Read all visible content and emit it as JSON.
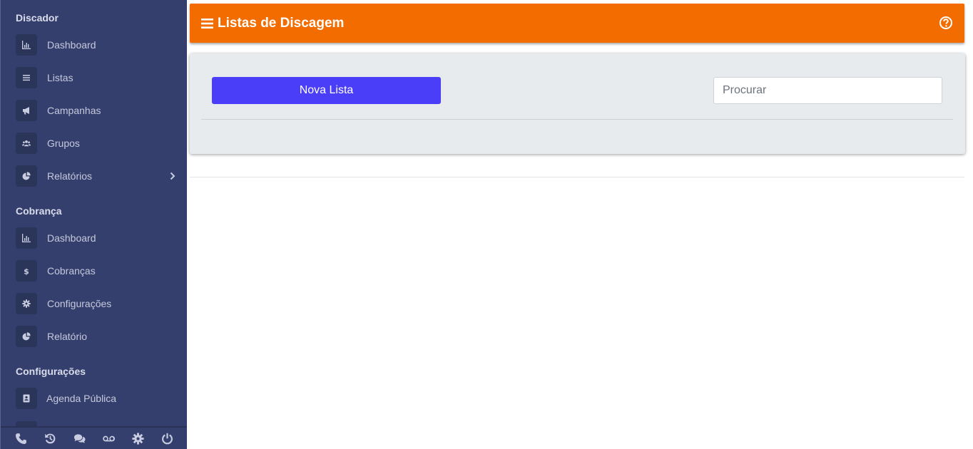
{
  "sidebar": {
    "sections": [
      {
        "title": "Discador",
        "items": [
          {
            "label": "Dashboard",
            "icon": "chart-bar-icon"
          },
          {
            "label": "Listas",
            "icon": "list-icon"
          },
          {
            "label": "Campanhas",
            "icon": "megaphone-icon"
          },
          {
            "label": "Grupos",
            "icon": "users-icon"
          },
          {
            "label": "Relatórios",
            "icon": "pie-chart-icon",
            "expandable": true
          }
        ]
      },
      {
        "title": "Cobrança",
        "items": [
          {
            "label": "Dashboard",
            "icon": "chart-bar-icon"
          },
          {
            "label": "Cobranças",
            "icon": "dollar-icon"
          },
          {
            "label": "Configurações",
            "icon": "gear-icon"
          },
          {
            "label": "Relatório",
            "icon": "pie-chart-icon"
          }
        ]
      },
      {
        "title": "Configurações",
        "items": [
          {
            "label": "Agenda Pública",
            "icon": "address-book-icon"
          }
        ]
      }
    ],
    "bottom_icons": [
      "phone-icon",
      "history-icon",
      "chat-icon",
      "voicemail-icon",
      "gear-icon",
      "power-icon"
    ]
  },
  "header": {
    "title": "Listas de Discagem",
    "menu_icon": "hamburger-icon",
    "help_icon": "question-circle-icon",
    "color": "#f26c00"
  },
  "panel": {
    "new_button_label": "Nova Lista",
    "new_button_color": "#4b3ef9",
    "search_placeholder": "Procurar",
    "search_value": ""
  }
}
